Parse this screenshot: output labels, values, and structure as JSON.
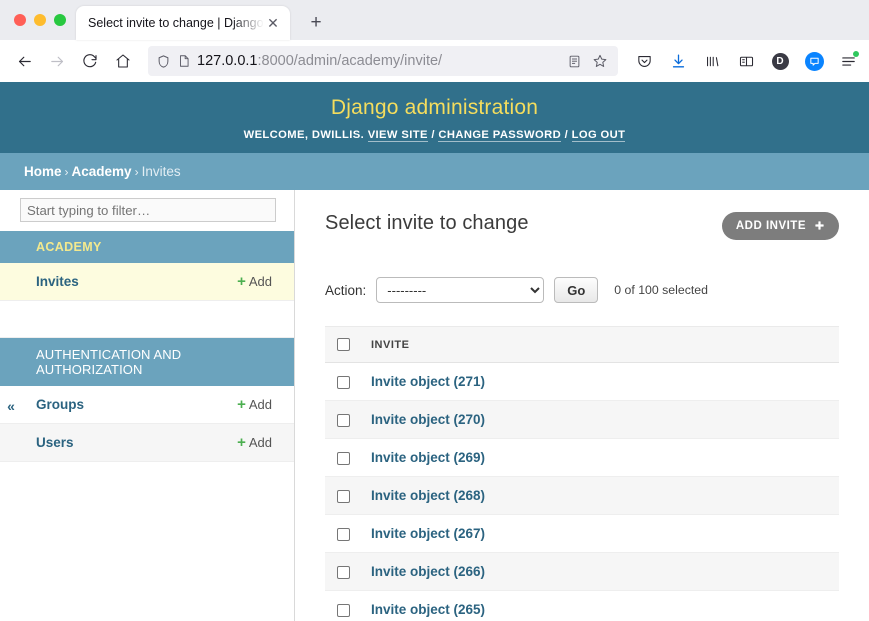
{
  "browser": {
    "tab": {
      "title": "Select invite to change | Django site ",
      "close_icon": "close-icon"
    },
    "new_tab_icon": "plus-icon",
    "nav": {
      "back_icon": "back-arrow-icon",
      "forward_icon": "forward-arrow-icon",
      "reload_icon": "reload-icon",
      "home_icon": "home-icon"
    },
    "url": {
      "host": "127.0.0.1",
      "rest": ":8000/admin/academy/invite/",
      "shield_icon": "shield-icon",
      "page_icon": "page-icon",
      "reader_icon": "reader-view-icon",
      "bookmark_icon": "star-icon"
    },
    "toolbar_icons": [
      "pocket-icon",
      "download-icon",
      "library-icon",
      "sidebar-icon",
      "account-d-icon",
      "profile-circle-icon",
      "menu-icon"
    ],
    "account_initial": "D"
  },
  "django": {
    "branding": "Django administration",
    "welcome_prefix": "WELCOME,",
    "username": "DWILLIS",
    "welcome_suffix": ".",
    "links": {
      "view_site": "VIEW SITE",
      "change_password": "CHANGE PASSWORD",
      "log_out": "LOG OUT",
      "separator": "/"
    },
    "breadcrumbs": {
      "home": "Home",
      "app": "Academy",
      "current": "Invites",
      "chevron": "›"
    }
  },
  "sidebar": {
    "filter_placeholder": "Start typing to filter…",
    "collapse_icon": "«",
    "apps": [
      {
        "name": "ACADEMY",
        "models": [
          {
            "label": "Invites",
            "add_label": "Add",
            "add_plus": "+",
            "current": true
          }
        ]
      },
      {
        "name": "AUTHENTICATION AND AUTHORIZATION",
        "models": [
          {
            "label": "Groups",
            "add_label": "Add",
            "add_plus": "+",
            "current": false
          },
          {
            "label": "Users",
            "add_label": "Add",
            "add_plus": "+",
            "current": false
          }
        ]
      }
    ]
  },
  "main": {
    "title": "Select invite to change",
    "add_button": {
      "label": "ADD INVITE",
      "plus": "➕"
    },
    "action_label": "Action:",
    "action_selected": "---------",
    "action_options": [
      "---------"
    ],
    "go_label": "Go",
    "selection_count": "0 of 100 selected",
    "table": {
      "columns": [
        "INVITE"
      ],
      "rows": [
        {
          "name": "Invite object (271)"
        },
        {
          "name": "Invite object (270)"
        },
        {
          "name": "Invite object (269)"
        },
        {
          "name": "Invite object (268)"
        },
        {
          "name": "Invite object (267)"
        },
        {
          "name": "Invite object (266)"
        },
        {
          "name": "Invite object (265)"
        }
      ]
    }
  },
  "colors": {
    "header_bg": "#31708b",
    "breadcrumb_bg": "#6ba3bd",
    "brand_yellow": "#f5dd5d",
    "link_blue": "#2b6380",
    "current_row": "#fdfcdf",
    "add_green": "#4caf50",
    "button_gray": "#7d7d7d"
  }
}
